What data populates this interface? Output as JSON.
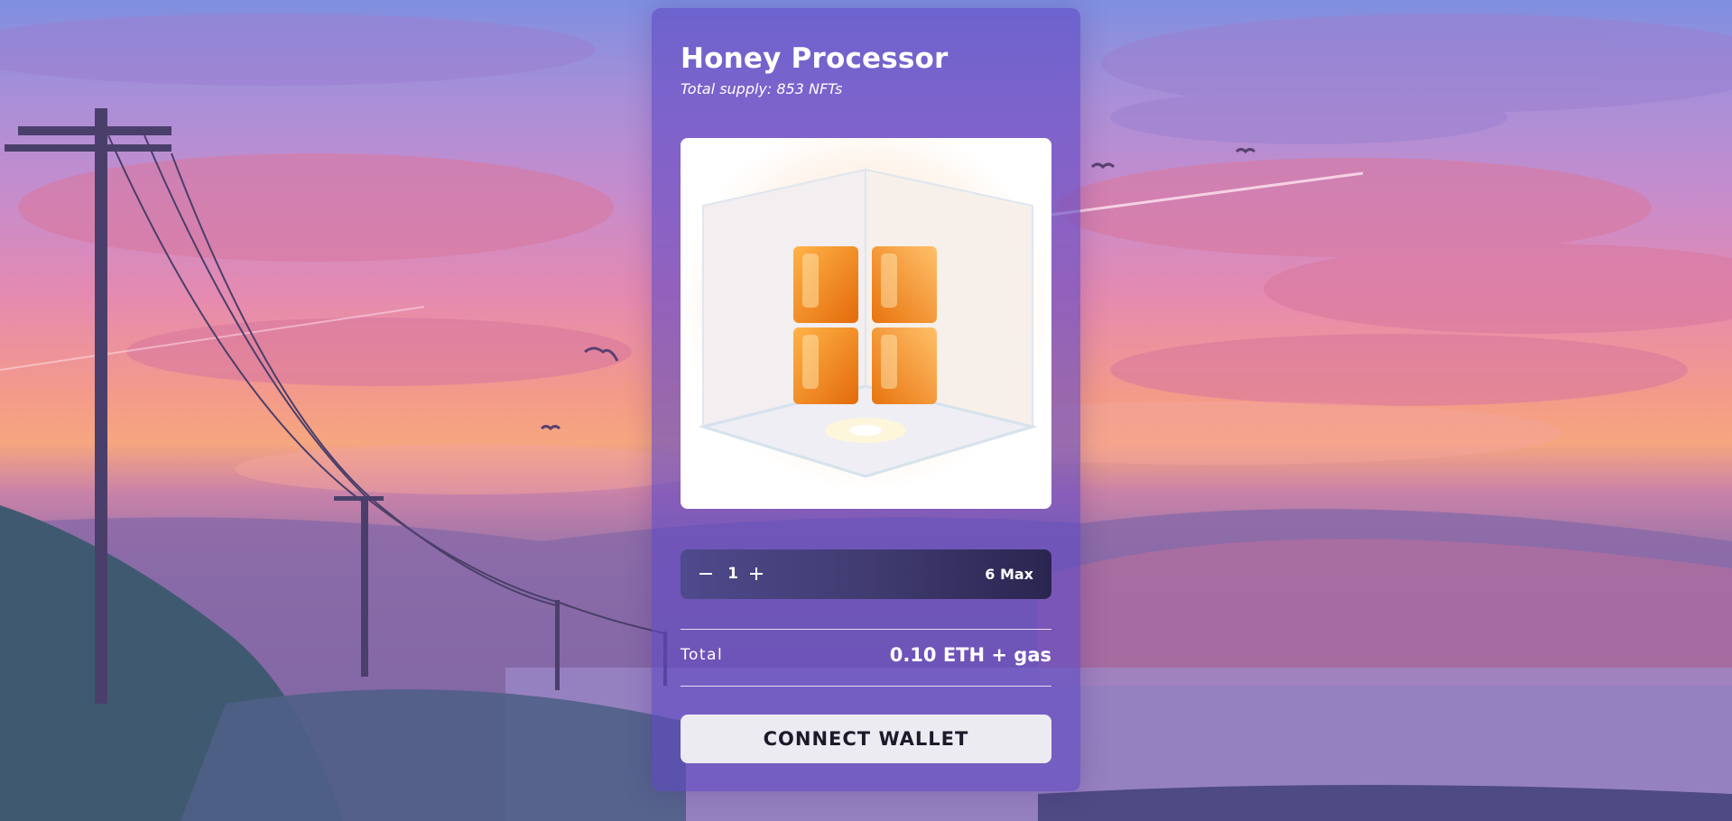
{
  "mint": {
    "title": "Honey Processor",
    "supply_text": "Total supply: 853 NFTs",
    "image_alt": "honey-cube-nft",
    "quantity": {
      "minus_icon": "minus-icon",
      "plus_icon": "plus-icon",
      "value": "1",
      "max_label": "6 Max"
    },
    "total": {
      "label": "Total",
      "value": "0.10 ETH + gas"
    },
    "connect_label": "CONNECT WALLET"
  },
  "colors": {
    "card": "#6048c4",
    "button_bg": "#ecebf1",
    "honey": "#f08a1e"
  }
}
